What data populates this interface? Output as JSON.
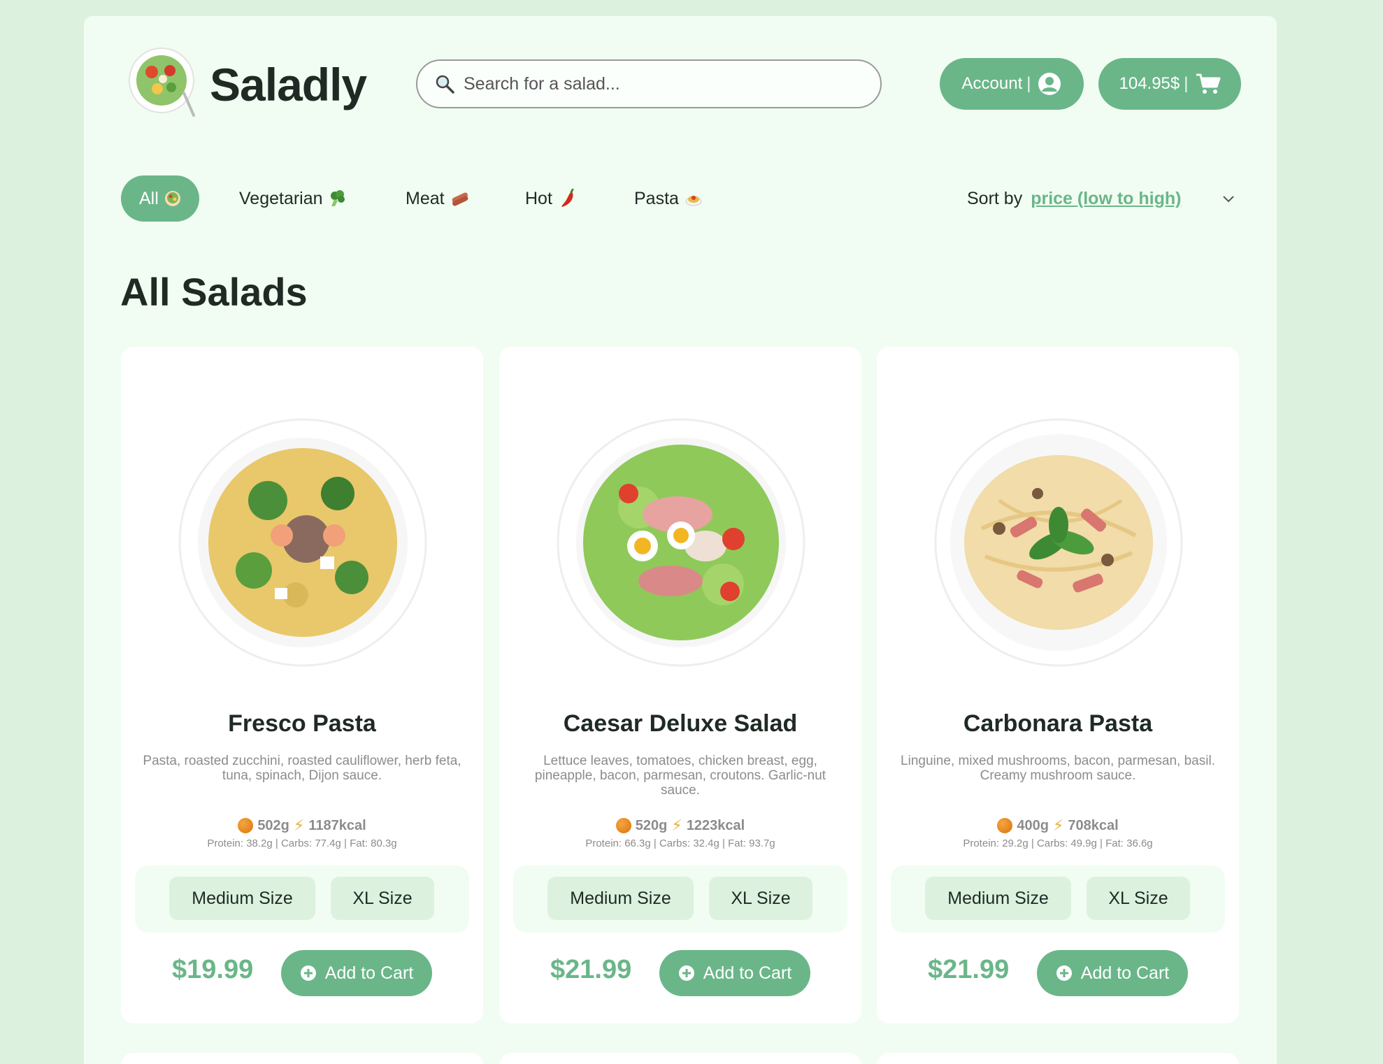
{
  "brand": {
    "name": "Saladly",
    "logo": "salad-bowl-logo"
  },
  "search": {
    "placeholder": "Search for a salad...",
    "value": ""
  },
  "header": {
    "account_label": "Account",
    "cart_total": "104.95$",
    "separator": "|"
  },
  "filters": [
    {
      "label": "All",
      "icon": "salad-emoji",
      "active": true
    },
    {
      "label": "Vegetarian",
      "icon": "broccoli-emoji",
      "active": false
    },
    {
      "label": "Meat",
      "icon": "sausage-emoji",
      "active": false
    },
    {
      "label": "Hot",
      "icon": "chili-emoji",
      "active": false
    },
    {
      "label": "Pasta",
      "icon": "pasta-emoji",
      "active": false
    }
  ],
  "sort": {
    "label": "Sort by",
    "value": "price (low to high)"
  },
  "section_title": "All Salads",
  "products": [
    {
      "name": "Fresco Pasta",
      "description": "Pasta, roasted zucchini, roasted cauliflower, herb feta, tuna, spinach, Dijon sauce.",
      "weight": "502g",
      "kcal": "1187kcal",
      "macros": "Protein: 38.2g | Carbs: 77.4g | Fat: 80.3g",
      "sizes": [
        "Medium Size",
        "XL Size"
      ],
      "price": "$19.99",
      "cta": "Add to Cart"
    },
    {
      "name": "Caesar Deluxe Salad",
      "description": "Lettuce leaves, tomatoes, chicken breast, egg, pineapple, bacon, parmesan, croutons. Garlic-nut sauce.",
      "weight": "520g",
      "kcal": "1223kcal",
      "macros": "Protein: 66.3g | Carbs: 32.4g | Fat: 93.7g",
      "sizes": [
        "Medium Size",
        "XL Size"
      ],
      "price": "$21.99",
      "cta": "Add to Cart"
    },
    {
      "name": "Carbonara Pasta",
      "description": "Linguine, mixed mushrooms, bacon, parmesan, basil. Creamy mushroom sauce.",
      "weight": "400g",
      "kcal": "708kcal",
      "macros": "Protein: 29.2g | Carbs: 49.9g | Fat: 36.6g",
      "sizes": [
        "Medium Size",
        "XL Size"
      ],
      "price": "$21.99",
      "cta": "Add to Cart"
    }
  ],
  "colors": {
    "accent": "#6ab689",
    "background": "#dcf2df",
    "panel": "#f1fdf2",
    "text": "#1f2a24",
    "muted": "#8c8c8c"
  }
}
